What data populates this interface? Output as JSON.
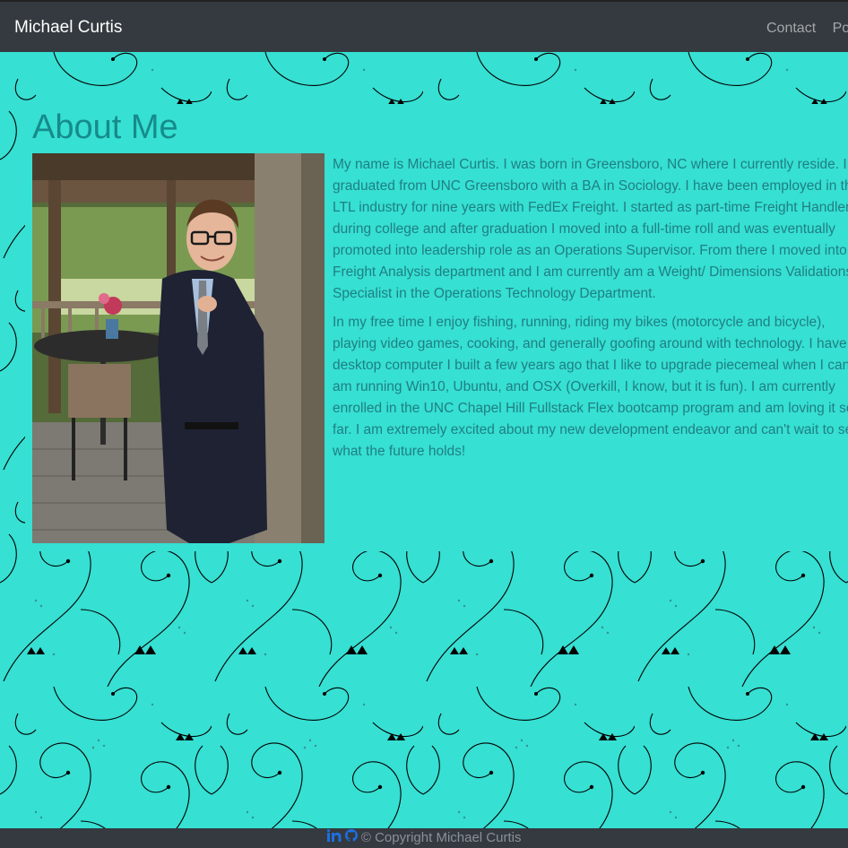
{
  "navbar": {
    "brand": "Michael Curtis",
    "links": [
      "Contact",
      "Portfolio"
    ]
  },
  "about": {
    "title": "About Me",
    "paragraphs": [
      "My name is Michael Curtis. I was born in Greensboro, NC where I currently reside. I graduated from UNC Greensboro with a BA in Sociology. I have been employed in the LTL industry for nine years with FedEx Freight. I started as part-time Freight Handler during college and after graduation I moved into a full-time roll and was eventually promoted into leadership role as an Operations Supervisor. From there I moved into the Freight Analysis department and I am currently am a Weight/ Dimensions Validations Specialist in the Operations Technology Department.",
      "In my free time I enjoy fishing, running, riding my bikes (motorcycle and bicycle), playing video games, cooking, and generally goofing around with technology. I have a desktop computer I built a few years ago that I like to upgrade piecemeal when I can. I am running Win10, Ubuntu, and OSX (Overkill, I know, but it is fun). I am currently enrolled in the UNC Chapel Hill Fullstack Flex bootcamp program and am loving it so far. I am extremely excited about my new development endeavor and can't wait to see what the future holds!"
    ]
  },
  "footer": {
    "copyright": "© Copyright Michael Curtis",
    "icons": [
      "linkedin-icon",
      "github-icon"
    ]
  },
  "colors": {
    "navbar_bg": "#343a40",
    "page_bg": "#36e0d3",
    "title": "#168b8b",
    "body_text": "#1f7f83",
    "link_blue": "#1d6fe0"
  }
}
